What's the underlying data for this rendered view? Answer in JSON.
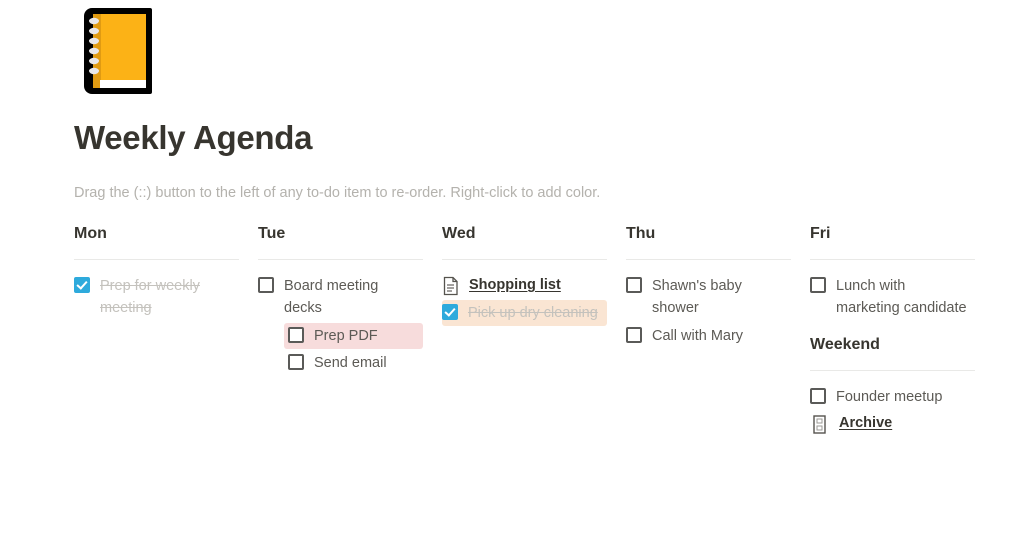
{
  "page": {
    "icon": "notebook-emoji",
    "title": "Weekly Agenda",
    "subtitle": "Drag the (::) button to the left of any to-do item to re-order. Right-click to add color."
  },
  "colors": {
    "checkbox_checked": "#2EAADC",
    "checkbox_border": "#5A5A58",
    "highlight_pink": "#F7DCDC",
    "highlight_orange": "#FAE5D3",
    "text_primary": "#37352F",
    "text_secondary": "#5C5A55",
    "text_muted": "#B4B2AD",
    "text_done": "#C4C2BD",
    "divider": "#E9E9E7"
  },
  "columns": [
    {
      "heading": "Mon",
      "sections": [
        {
          "items": [
            {
              "type": "todo",
              "label": "Prep for weekly meeting",
              "checked": true,
              "indent": false,
              "highlight": "none"
            }
          ]
        }
      ]
    },
    {
      "heading": "Tue",
      "sections": [
        {
          "items": [
            {
              "type": "todo",
              "label": "Board meeting decks",
              "checked": false,
              "indent": false,
              "highlight": "none"
            },
            {
              "type": "todo",
              "label": "Prep PDF",
              "checked": false,
              "indent": true,
              "highlight": "pink"
            },
            {
              "type": "todo",
              "label": "Send email",
              "checked": false,
              "indent": true,
              "highlight": "none"
            }
          ]
        }
      ]
    },
    {
      "heading": "Wed",
      "sections": [
        {
          "items": [
            {
              "type": "pagelink",
              "label": "Shopping list",
              "icon": "document-icon"
            },
            {
              "type": "todo",
              "label": "Pick up dry cleaning",
              "checked": true,
              "indent": false,
              "highlight": "orange"
            }
          ]
        }
      ]
    },
    {
      "heading": "Thu",
      "sections": [
        {
          "items": [
            {
              "type": "todo",
              "label": "Shawn's baby shower",
              "checked": false,
              "indent": false,
              "highlight": "none"
            },
            {
              "type": "todo",
              "label": "Call with Mary",
              "checked": false,
              "indent": false,
              "highlight": "none"
            }
          ]
        }
      ]
    },
    {
      "heading": "Fri",
      "sections": [
        {
          "items": [
            {
              "type": "todo",
              "label": "Lunch with marketing candidate",
              "checked": false,
              "indent": false,
              "highlight": "none"
            }
          ]
        },
        {
          "heading": "Weekend",
          "items": [
            {
              "type": "todo",
              "label": "Founder meetup",
              "checked": false,
              "indent": false,
              "highlight": "none"
            },
            {
              "type": "pagelink",
              "label": "Archive",
              "icon": "archive-icon"
            }
          ]
        }
      ]
    }
  ]
}
